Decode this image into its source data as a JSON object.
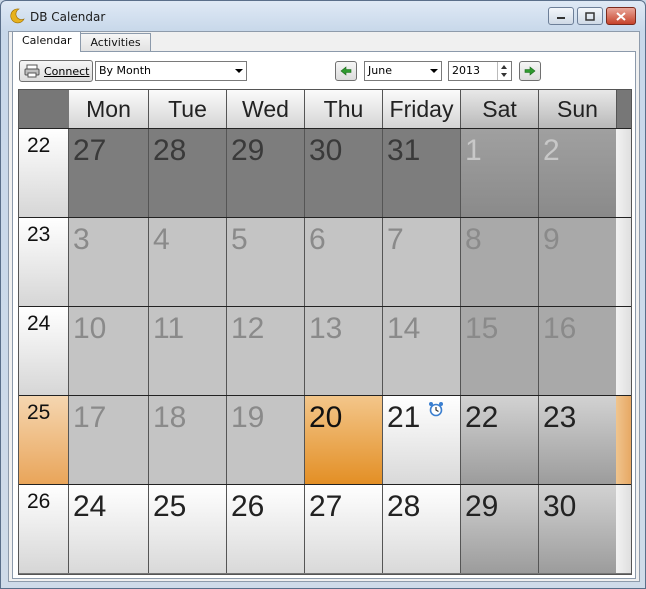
{
  "window": {
    "title": "DB Calendar"
  },
  "tabs": [
    {
      "label": "Calendar"
    },
    {
      "label": "Activities"
    }
  ],
  "toolbar": {
    "connect_label": "Connect",
    "view_mode": "By Month",
    "month": "June",
    "year": "2013"
  },
  "calendar": {
    "headers": [
      "Mon",
      "Tue",
      "Wed",
      "Thu",
      "Friday",
      "Sat",
      "Sun"
    ],
    "weeks": [
      {
        "week": "22",
        "days": [
          "27",
          "28",
          "29",
          "30",
          "31",
          "1",
          "2"
        ]
      },
      {
        "week": "23",
        "days": [
          "3",
          "4",
          "5",
          "6",
          "7",
          "8",
          "9"
        ]
      },
      {
        "week": "24",
        "days": [
          "10",
          "11",
          "12",
          "13",
          "14",
          "15",
          "16"
        ]
      },
      {
        "week": "25",
        "days": [
          "17",
          "18",
          "19",
          "20",
          "21",
          "22",
          "23"
        ]
      },
      {
        "week": "26",
        "days": [
          "24",
          "25",
          "26",
          "27",
          "28",
          "29",
          "30"
        ]
      }
    ],
    "today": "20",
    "event_icon": "alarm-clock-icon",
    "colors": {
      "today": "#e38f25",
      "current_week": "#e9a55a"
    }
  }
}
